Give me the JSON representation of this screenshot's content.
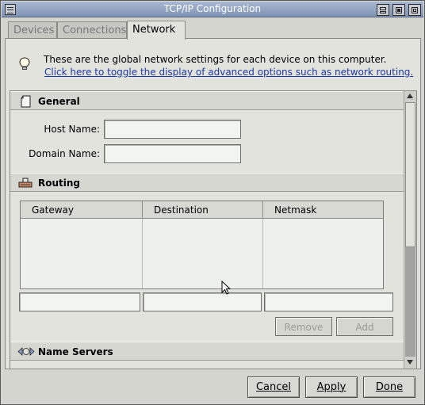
{
  "window": {
    "title": "TCP/IP Configuration"
  },
  "tabs": [
    {
      "label": "Devices"
    },
    {
      "label": "Connections"
    },
    {
      "label": "Network"
    }
  ],
  "info": {
    "text": "These are the global network settings for each device on this computer.",
    "link": "Click here to toggle the display of advanced options such as network routing."
  },
  "general": {
    "title": "General",
    "host_name_label": "Host Name:",
    "host_name_value": "",
    "domain_name_label": "Domain Name:",
    "domain_name_value": ""
  },
  "routing": {
    "title": "Routing",
    "columns": [
      "Gateway",
      "Destination",
      "Netmask"
    ],
    "gateway_value": "",
    "destination_value": "",
    "netmask_value": "",
    "remove_label": "Remove",
    "add_label": "Add"
  },
  "name_servers": {
    "title": "Name Servers"
  },
  "buttons": {
    "cancel": "Cancel",
    "apply": "Apply",
    "done": "Done"
  }
}
